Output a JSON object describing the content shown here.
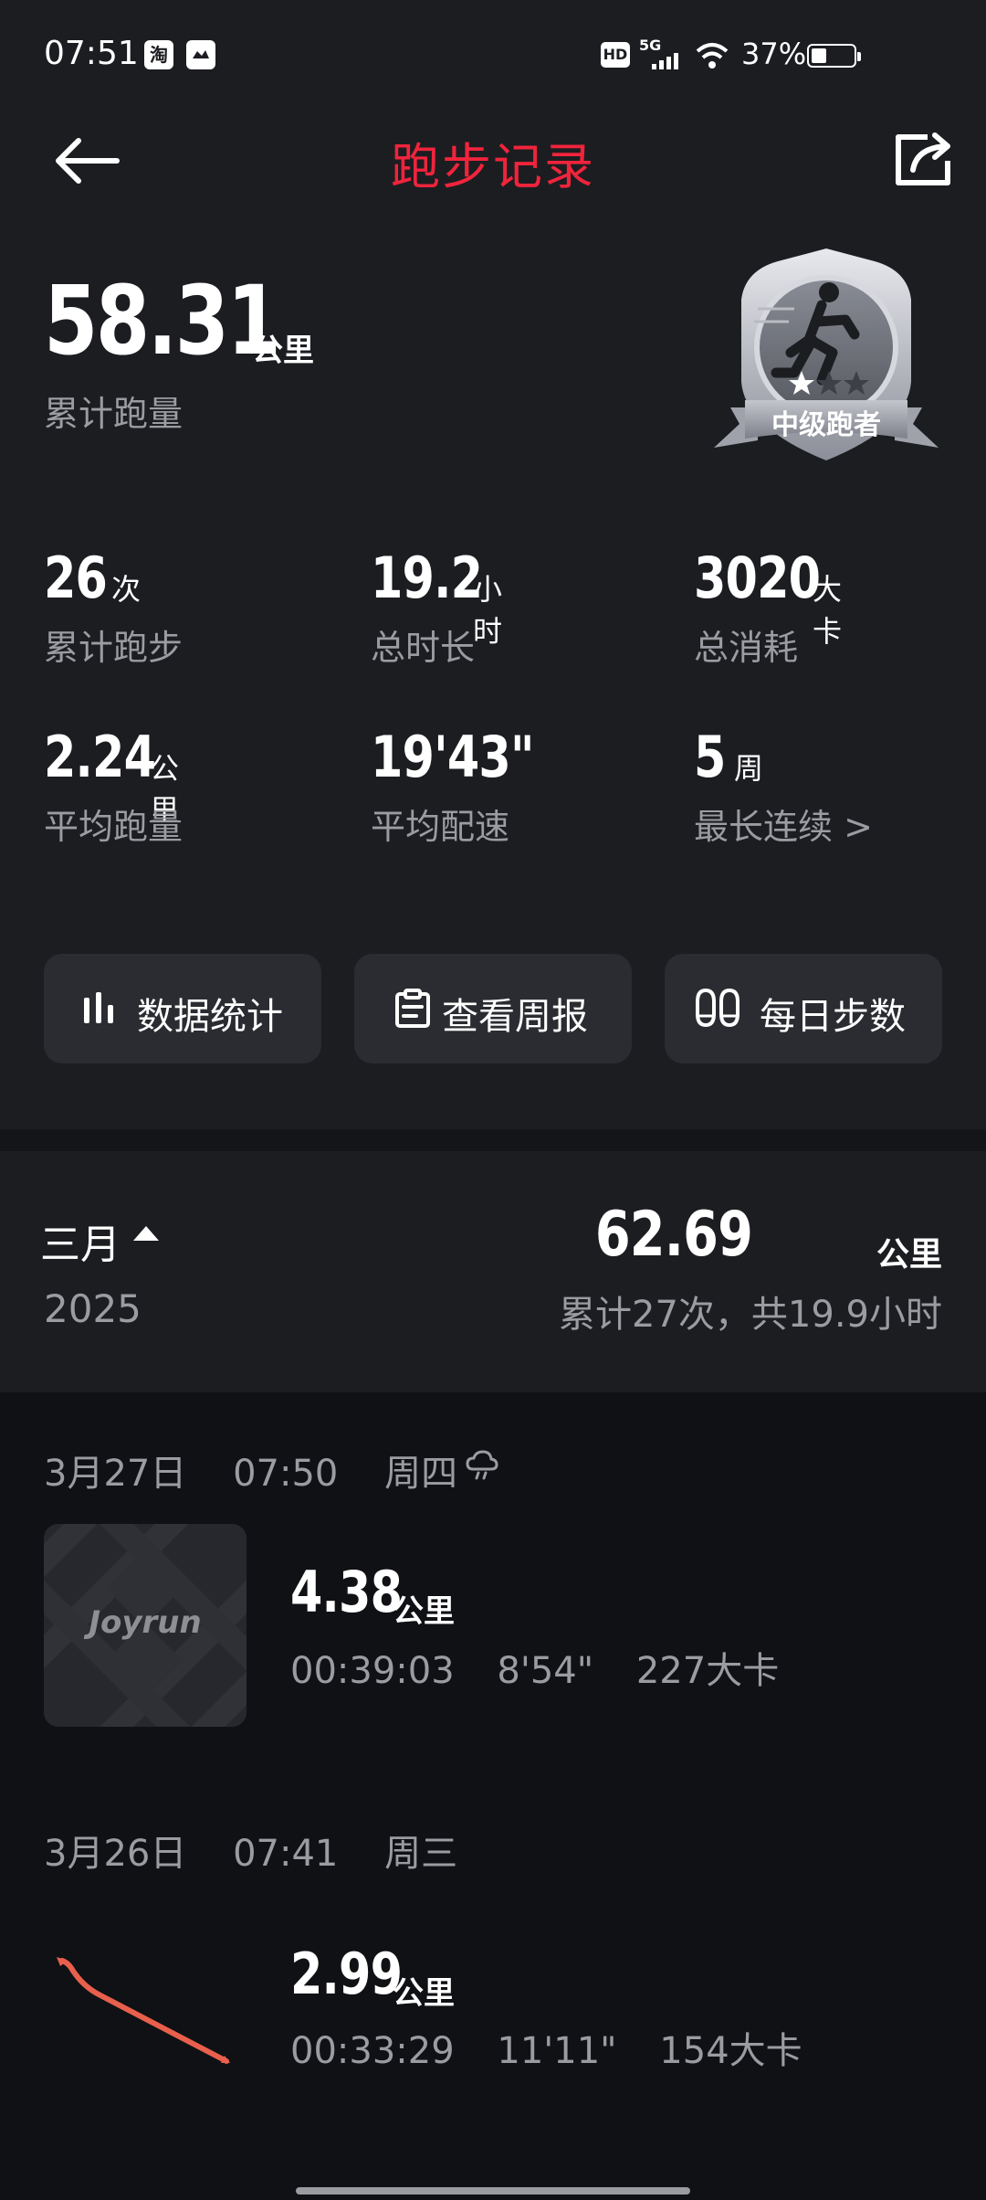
{
  "status_bar": {
    "time": "07:51",
    "app_icon_1": "淘",
    "hd": "HD",
    "network": "5G",
    "battery": "37%"
  },
  "header": {
    "title": "跑步记录"
  },
  "summary": {
    "total_distance": "58.31",
    "total_unit": "公里",
    "total_label": "累计跑量",
    "badge_label": "中级跑者"
  },
  "stats": [
    {
      "value": "26",
      "unit": "次",
      "label": "累计跑步"
    },
    {
      "value": "19.2",
      "unit": "小时",
      "label": "总时长"
    },
    {
      "value": "3020",
      "unit": "大卡",
      "label": "总消耗"
    },
    {
      "value": "2.24",
      "unit": "公里",
      "label": "平均跑量"
    },
    {
      "value": "19'43\"",
      "unit": "",
      "label": "平均配速"
    },
    {
      "value": "5",
      "unit": "周",
      "label": "最长连续 >"
    }
  ],
  "actions": [
    {
      "label": "数据统计",
      "icon": "bar-chart-icon"
    },
    {
      "label": "查看周报",
      "icon": "clipboard-icon"
    },
    {
      "label": "每日步数",
      "icon": "footprints-icon"
    }
  ],
  "month": {
    "name": "三月",
    "year": "2025",
    "total": "62.69",
    "unit": "公里",
    "summary": "累计27次，共19.9小时"
  },
  "runs": [
    {
      "date": "3月27日",
      "time": "07:50",
      "weekday": "周四",
      "thumb_text": "Joyrun",
      "distance": "4.38",
      "unit": "公里",
      "duration": "00:39:03",
      "pace": "8'54\"",
      "calories": "227大卡"
    },
    {
      "date": "3月26日",
      "time": "07:41",
      "weekday": "周三",
      "distance": "2.99",
      "unit": "公里",
      "duration": "00:33:29",
      "pace": "11'11\"",
      "calories": "154大卡"
    }
  ],
  "colors": {
    "accent": "#f0243c",
    "background": "#1c1d21",
    "list_background": "#101115",
    "muted_text": "#9a9ca2",
    "route_line": "#e8604c"
  }
}
